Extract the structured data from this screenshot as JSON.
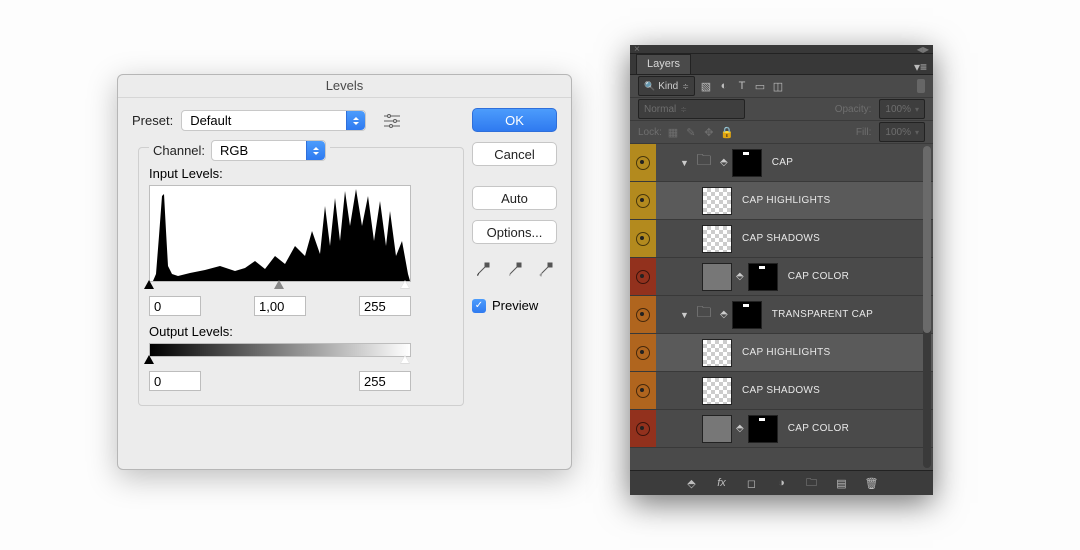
{
  "levels": {
    "title": "Levels",
    "preset_label": "Preset:",
    "preset_value": "Default",
    "channel_label": "Channel:",
    "channel_value": "RGB",
    "input_label": "Input Levels:",
    "input_black": "0",
    "input_gamma": "1,00",
    "input_white": "255",
    "output_label": "Output Levels:",
    "output_black": "0",
    "output_white": "255",
    "ok": "OK",
    "cancel": "Cancel",
    "auto": "Auto",
    "options": "Options...",
    "preview": "Preview",
    "preview_checked": true
  },
  "layersPanel": {
    "tab": "Layers",
    "filter_label": "Kind",
    "blend_mode": "Normal",
    "opacity_label": "Opacity:",
    "opacity_value": "100%",
    "lock_label": "Lock:",
    "fill_label": "Fill:",
    "fill_value": "100%",
    "layers": [
      {
        "vis": "yellow",
        "type": "group",
        "indent": 0,
        "name": "CAP",
        "sel": false
      },
      {
        "vis": "yellow",
        "type": "pixel",
        "indent": 2,
        "name": "CAP HIGHLIGHTS",
        "sel": true
      },
      {
        "vis": "yellow",
        "type": "pixel",
        "indent": 2,
        "name": "CAP SHADOWS",
        "sel": false
      },
      {
        "vis": "brown",
        "type": "adjust",
        "indent": 2,
        "name": "CAP COLOR",
        "sel": false
      },
      {
        "vis": "orange",
        "type": "group",
        "indent": 0,
        "name": "TRANSPARENT CAP",
        "sel": false
      },
      {
        "vis": "orange",
        "type": "pixel",
        "indent": 2,
        "name": "CAP HIGHLIGHTS",
        "sel": true
      },
      {
        "vis": "orange",
        "type": "pixel",
        "indent": 2,
        "name": "CAP SHADOWS",
        "sel": false
      },
      {
        "vis": "brown",
        "type": "adjust",
        "indent": 2,
        "name": "CAP COLOR",
        "sel": false
      }
    ]
  }
}
